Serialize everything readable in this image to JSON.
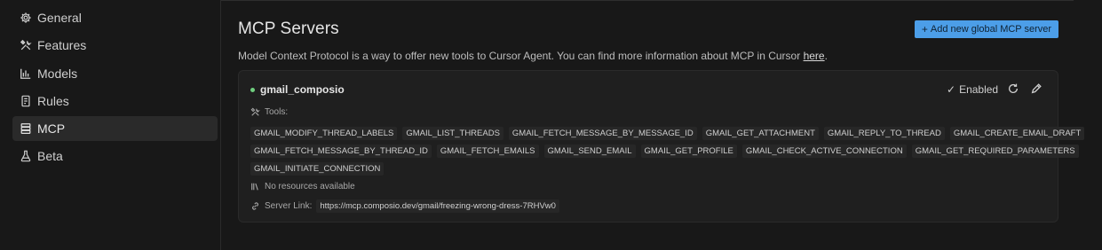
{
  "sidebar": {
    "items": [
      {
        "label": "General",
        "icon": "gear-icon",
        "active": false
      },
      {
        "label": "Features",
        "icon": "tools-icon",
        "active": false
      },
      {
        "label": "Models",
        "icon": "bar-chart-icon",
        "active": false
      },
      {
        "label": "Rules",
        "icon": "document-icon",
        "active": false
      },
      {
        "label": "MCP",
        "icon": "server-icon",
        "active": true
      },
      {
        "label": "Beta",
        "icon": "flask-icon",
        "active": false
      }
    ]
  },
  "main": {
    "title": "MCP Servers",
    "add_button_label": "Add new global MCP server",
    "description": "Model Context Protocol is a way to offer new tools to Cursor Agent. You can find more information about MCP in Cursor ",
    "description_link": "here",
    "description_end": "."
  },
  "server": {
    "name": "gmail_composio",
    "status_color": "#6fce7e",
    "enabled_label": "Enabled",
    "tools_label": "Tools:",
    "tools_rows": [
      [
        "GMAIL_MODIFY_THREAD_LABELS",
        "GMAIL_LIST_THREADS",
        "GMAIL_FETCH_MESSAGE_BY_MESSAGE_ID",
        "GMAIL_GET_ATTACHMENT",
        "GMAIL_REPLY_TO_THREAD",
        "GMAIL_CREATE_EMAIL_DRAFT"
      ],
      [
        "GMAIL_FETCH_MESSAGE_BY_THREAD_ID",
        "GMAIL_FETCH_EMAILS",
        "GMAIL_SEND_EMAIL",
        "GMAIL_GET_PROFILE",
        "GMAIL_CHECK_ACTIVE_CONNECTION",
        "GMAIL_GET_REQUIRED_PARAMETERS"
      ],
      [
        "GMAIL_INITIATE_CONNECTION"
      ]
    ],
    "resources_label": "No resources available",
    "link_label": "Server Link:",
    "link_url": "https://mcp.composio.dev/gmail/freezing-wrong-dress-7RHVw0"
  },
  "colors": {
    "accent": "#4c9ee8",
    "background": "#181818",
    "card": "#1f1f1f"
  }
}
